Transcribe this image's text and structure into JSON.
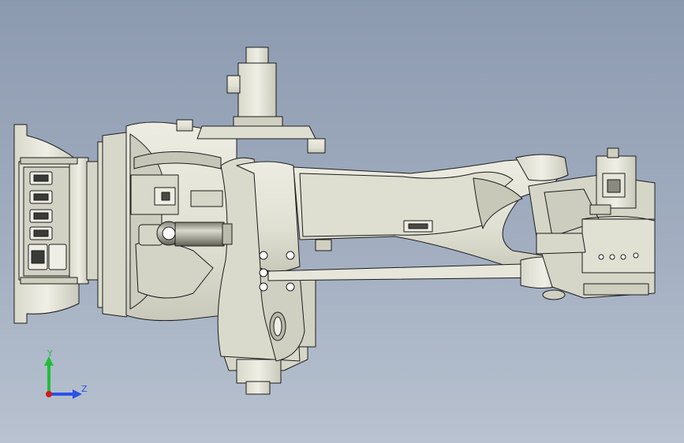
{
  "triad": {
    "y_label": "Y",
    "z_label": "Z",
    "y_color": "#1fbf3a",
    "z_color": "#2b52e6",
    "x_color": "#d11a1a"
  },
  "colors": {
    "part_fill": "#e4e4d8",
    "part_shadow": "#cfcfc2",
    "part_dark": "#b9b9ab",
    "edge": "#1c1c1c",
    "background_top": "#8c9ab0",
    "background_bottom": "#b8c2d0"
  }
}
